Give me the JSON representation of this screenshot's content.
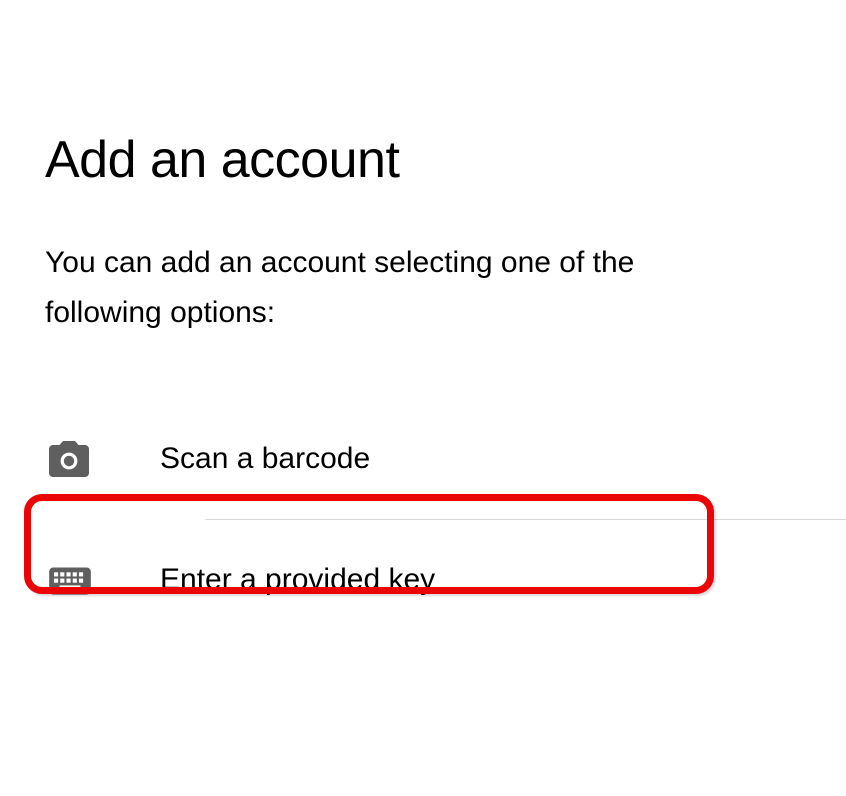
{
  "title": "Add an account",
  "subtitle": "You can add an account selecting one of the following options:",
  "options": [
    {
      "label": "Scan a barcode"
    },
    {
      "label": "Enter a provided key"
    }
  ]
}
